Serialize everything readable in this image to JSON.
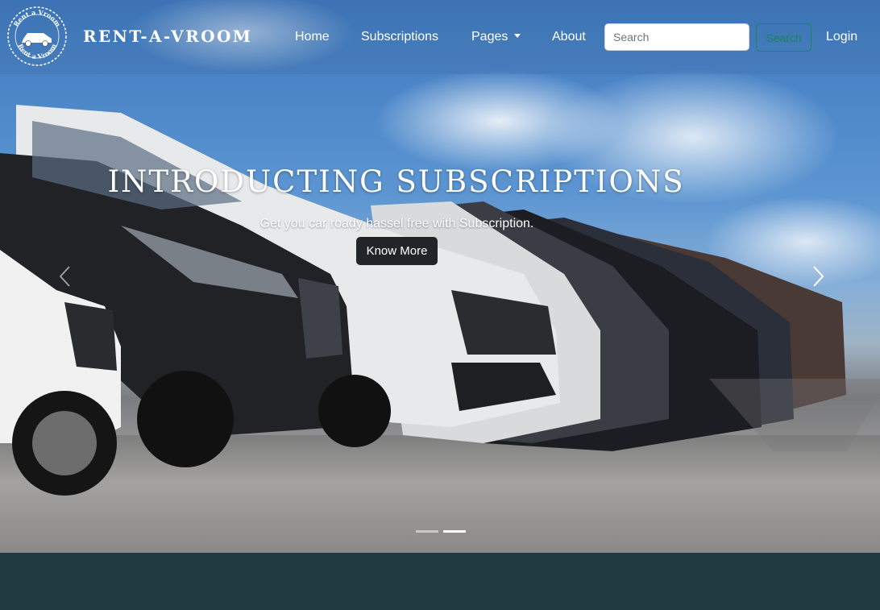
{
  "brand": {
    "name": "RENT-A-VROOM",
    "logo_text_top": "Rent a Vroom",
    "logo_text_bottom": "Rent a Vroom"
  },
  "nav": {
    "items": [
      {
        "label": "Home"
      },
      {
        "label": "Subscriptions"
      },
      {
        "label": "Pages"
      },
      {
        "label": "About"
      }
    ],
    "search_placeholder": "Search",
    "search_button": "Search",
    "login": "Login"
  },
  "carousel": {
    "title": "INTRODUCTING SUBSCRIPTIONS",
    "subtitle": "Get you car roady hassel free with Subscription.",
    "cta": "Know More",
    "active_slide": 2,
    "slide_count": 2
  },
  "colors": {
    "footer_band": "#1f3a40",
    "search_button": "#198754",
    "cta_button": "#212529"
  }
}
